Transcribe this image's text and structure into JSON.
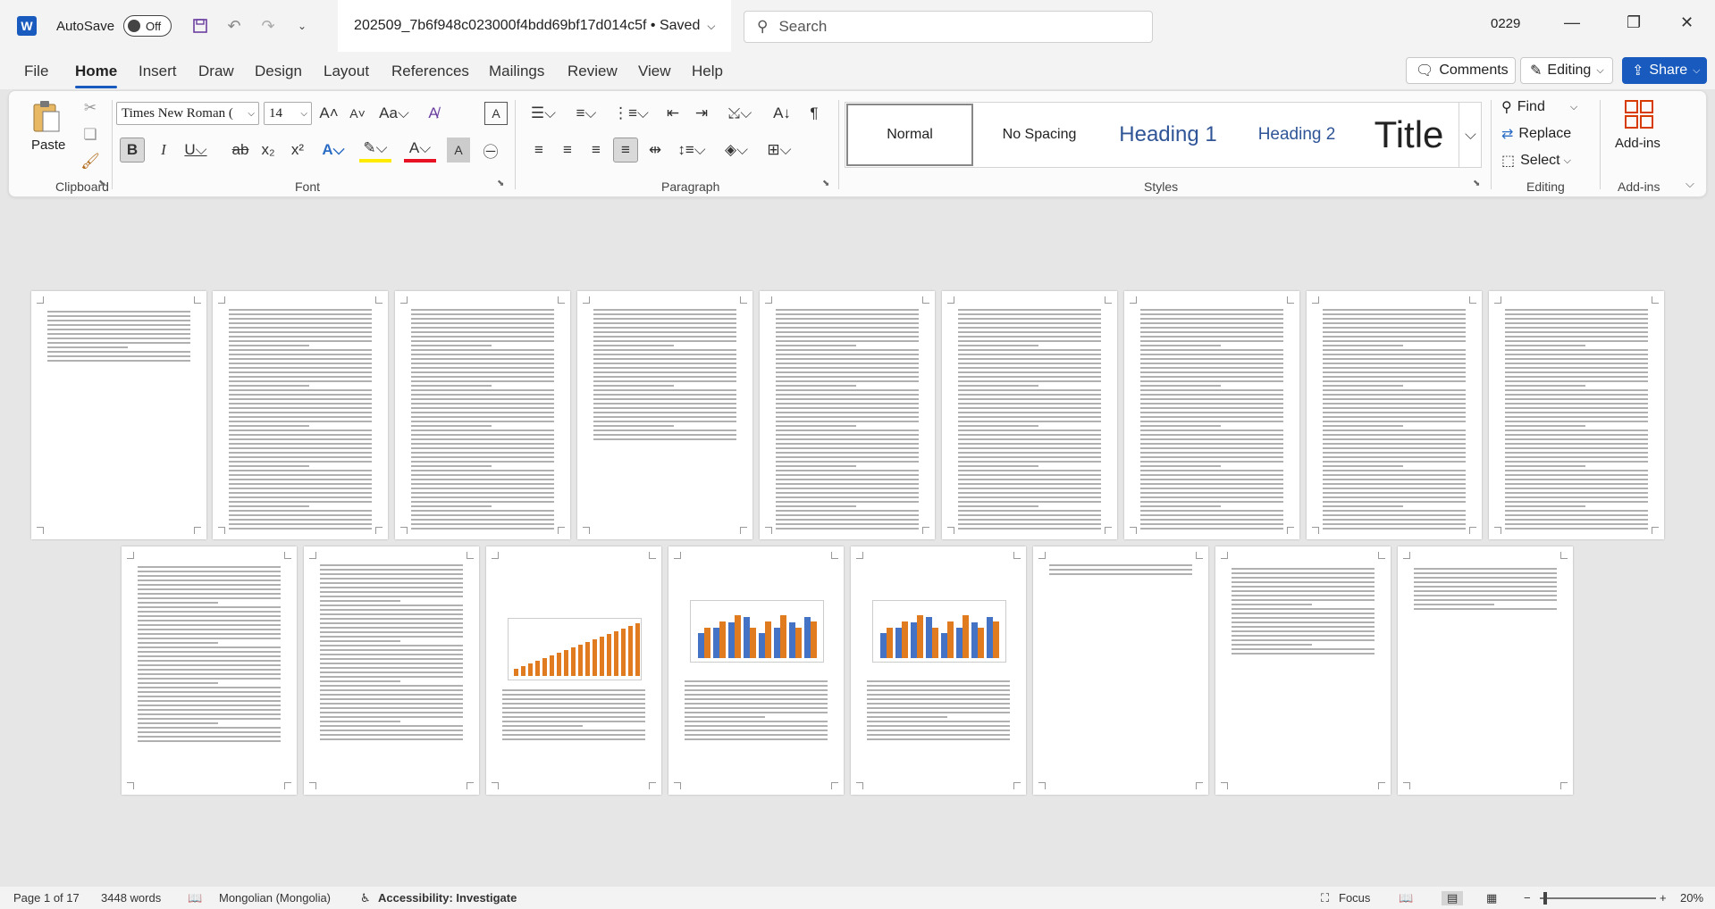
{
  "titlebar": {
    "autosave_label": "AutoSave",
    "autosave_state": "Off",
    "doc_title": "202509_7b6f948c023000f4bdd69bf17d014c5f • Saved",
    "search_placeholder": "Search",
    "user": "0229"
  },
  "menu": {
    "tabs": [
      "File",
      "Home",
      "Insert",
      "Draw",
      "Design",
      "Layout",
      "References",
      "Mailings",
      "Review",
      "View",
      "Help"
    ],
    "active": "Home",
    "comments_label": "Comments",
    "editing_label": "Editing",
    "share_label": "Share"
  },
  "ribbon": {
    "clipboard": {
      "paste_label": "Paste",
      "group_label": "Clipboard"
    },
    "font": {
      "font_name": "Times New Roman (",
      "font_size": "14",
      "group_label": "Font"
    },
    "paragraph": {
      "group_label": "Paragraph"
    },
    "styles": {
      "items": [
        "Normal",
        "No Spacing",
        "Heading 1",
        "Heading 2",
        "Title"
      ],
      "group_label": "Styles"
    },
    "editing": {
      "find_label": "Find",
      "replace_label": "Replace",
      "select_label": "Select",
      "group_label": "Editing"
    },
    "addins": {
      "label": "Add-ins",
      "group_label": "Add-ins"
    }
  },
  "status": {
    "page": "Page 1 of 17",
    "words": "3448 words",
    "language": "Mongolian (Mongolia)",
    "accessibility": "Accessibility: Investigate",
    "focus": "Focus",
    "zoom": "20%"
  },
  "colors": {
    "accent": "#185abd",
    "chrome": "#f3f3f3",
    "workspace": "#e6e6e6",
    "chart_orange": "#e07b20",
    "chart_blue": "#4472c4"
  }
}
